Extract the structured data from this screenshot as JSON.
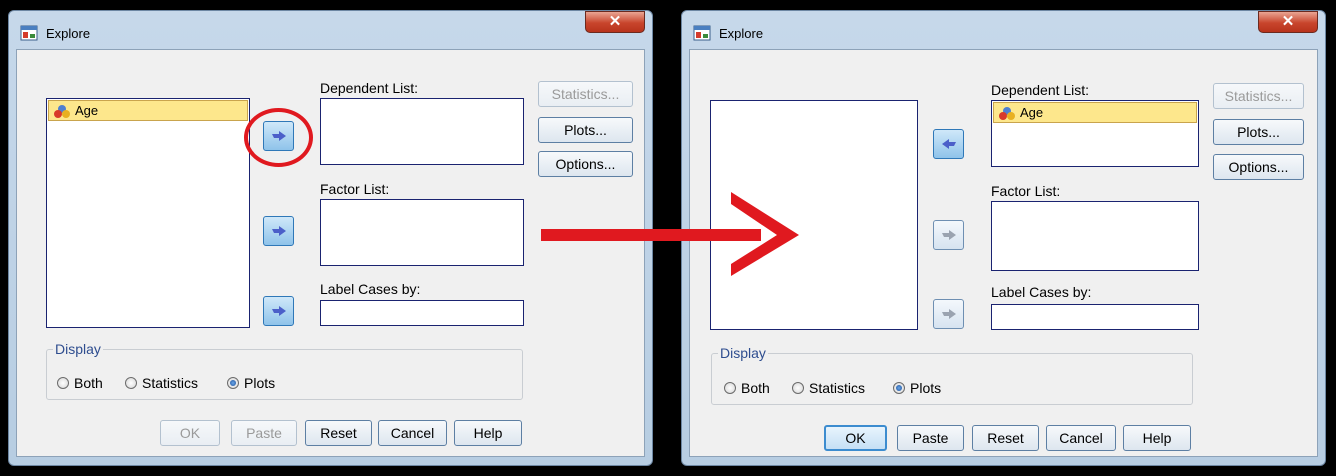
{
  "left_dialog": {
    "title": "Explore",
    "close_icon": "close-icon",
    "variables_list": [
      {
        "label": "Age",
        "icon": "scale-variable-icon"
      }
    ],
    "dependent_label": "Dependent List:",
    "dependent_items": [],
    "factor_label": "Factor List:",
    "label_cases_label": "Label Cases by:",
    "label_cases_value": "",
    "side_buttons": {
      "statistics": "Statistics...",
      "plots": "Plots...",
      "options": "Options..."
    },
    "display": {
      "legend": "Display",
      "both": "Both",
      "statistics": "Statistics",
      "plots": "Plots",
      "selected": "plots"
    },
    "buttons": {
      "ok": "OK",
      "paste": "Paste",
      "reset": "Reset",
      "cancel": "Cancel",
      "help": "Help"
    },
    "arrow_icon": "right-arrow-icon"
  },
  "right_dialog": {
    "title": "Explore",
    "close_icon": "close-icon",
    "variables_list": [],
    "dependent_label": "Dependent List:",
    "dependent_items": [
      {
        "label": "Age",
        "icon": "scale-variable-icon"
      }
    ],
    "factor_label": "Factor List:",
    "label_cases_label": "Label Cases by:",
    "label_cases_value": "",
    "side_buttons": {
      "statistics": "Statistics...",
      "plots": "Plots...",
      "options": "Options..."
    },
    "display": {
      "legend": "Display",
      "both": "Both",
      "statistics": "Statistics",
      "plots": "Plots",
      "selected": "plots"
    },
    "buttons": {
      "ok": "OK",
      "paste": "Paste",
      "reset": "Reset",
      "cancel": "Cancel",
      "help": "Help"
    },
    "arrow_icon": "left-arrow-icon"
  },
  "annotations": {
    "highlight_color": "#e0191f",
    "transition_arrow": "big-right-arrow-icon"
  }
}
